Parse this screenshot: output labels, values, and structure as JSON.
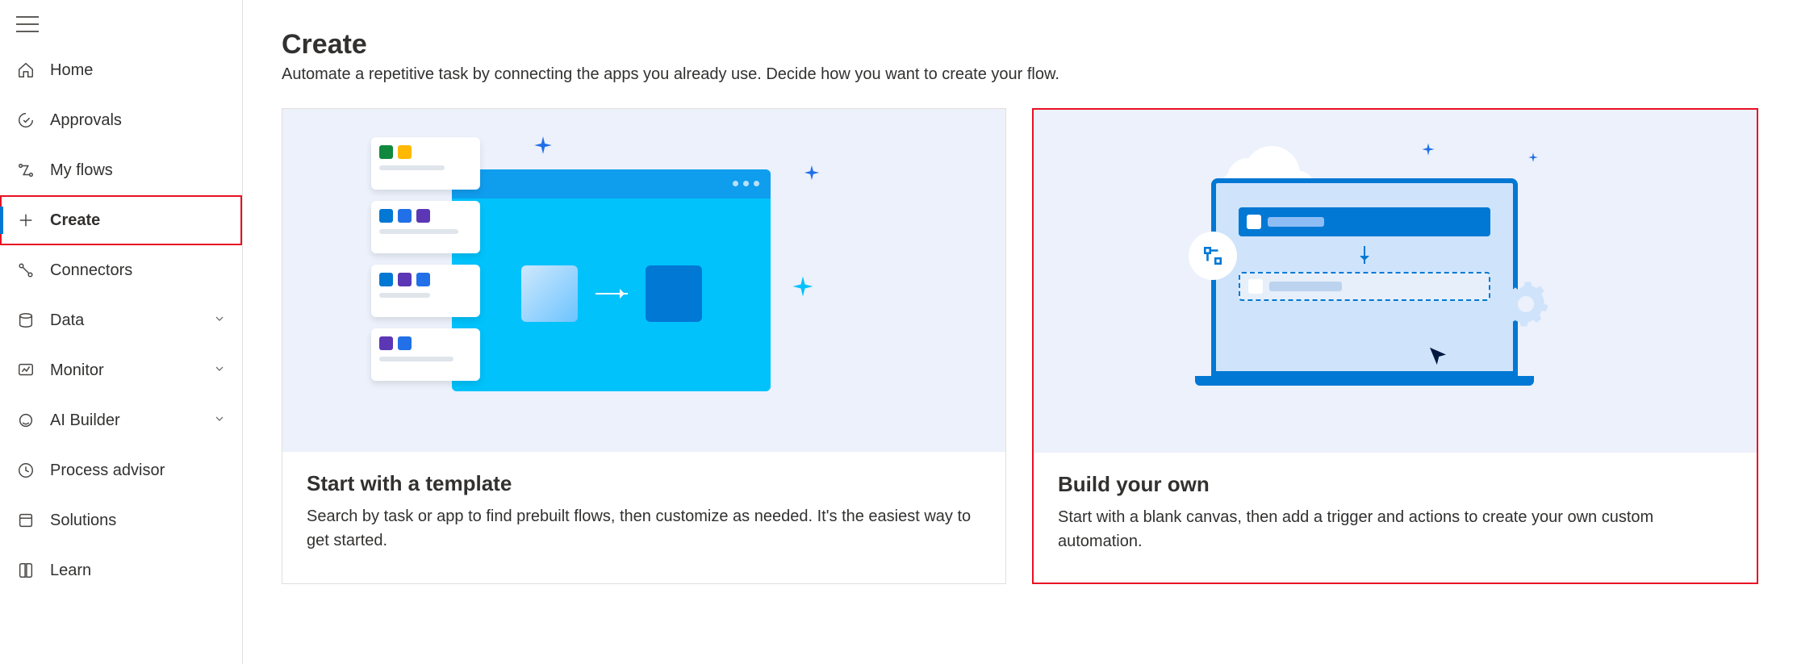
{
  "sidebar": {
    "items": [
      {
        "label": "Home",
        "icon": "home-icon",
        "chevron": false,
        "active": false
      },
      {
        "label": "Approvals",
        "icon": "approvals-icon",
        "chevron": false,
        "active": false
      },
      {
        "label": "My flows",
        "icon": "flows-icon",
        "chevron": false,
        "active": false
      },
      {
        "label": "Create",
        "icon": "plus-icon",
        "chevron": false,
        "active": true
      },
      {
        "label": "Connectors",
        "icon": "connectors-icon",
        "chevron": false,
        "active": false
      },
      {
        "label": "Data",
        "icon": "data-icon",
        "chevron": true,
        "active": false
      },
      {
        "label": "Monitor",
        "icon": "monitor-icon",
        "chevron": true,
        "active": false
      },
      {
        "label": "AI Builder",
        "icon": "ai-icon",
        "chevron": true,
        "active": false
      },
      {
        "label": "Process advisor",
        "icon": "process-icon",
        "chevron": false,
        "active": false
      },
      {
        "label": "Solutions",
        "icon": "solutions-icon",
        "chevron": false,
        "active": false
      },
      {
        "label": "Learn",
        "icon": "learn-icon",
        "chevron": false,
        "active": false
      }
    ]
  },
  "page": {
    "title": "Create",
    "subtitle": "Automate a repetitive task by connecting the apps you already use. Decide how you want to create your flow."
  },
  "cards": {
    "template": {
      "title": "Start with a template",
      "desc": "Search by task or app to find prebuilt flows, then customize as needed. It's the easiest way to get started."
    },
    "build": {
      "title": "Build your own",
      "desc": "Start with a blank canvas, then add a trigger and actions to create your own custom automation."
    }
  }
}
